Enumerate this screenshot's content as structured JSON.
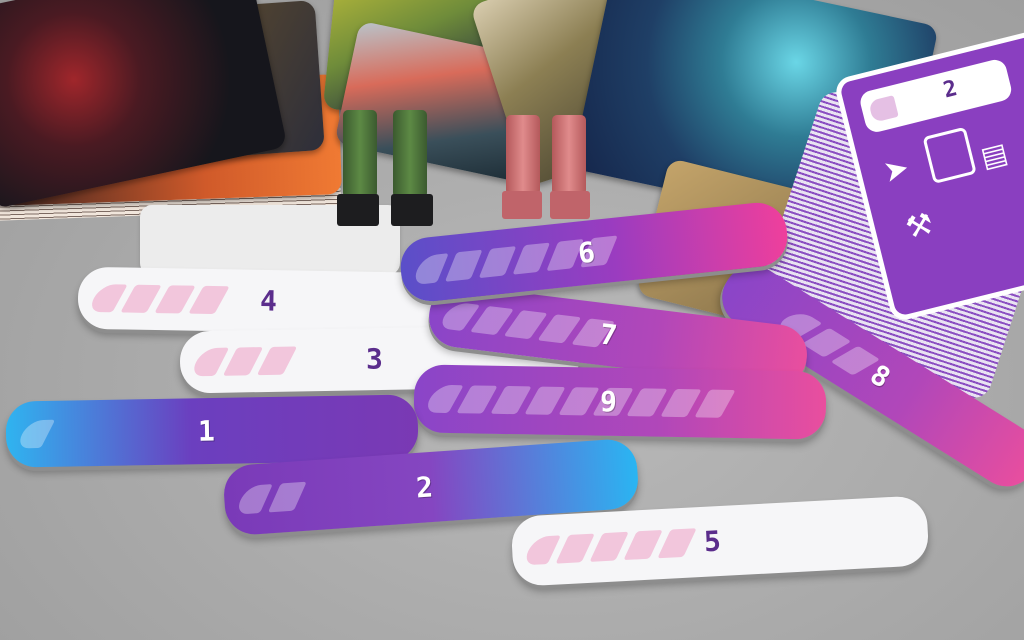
{
  "scene": {
    "description_colors": {
      "table": "#a9a9a9",
      "token_white": "#f6f6f8",
      "token_pink_stripe": "#f2c6dc",
      "token_purple": "#7a39b4",
      "token_blue": "#2fb4f0",
      "token_magenta": "#ef3f9c",
      "number_on_white": "#5b2d8c"
    },
    "tokens": [
      {
        "label": "1",
        "style": "gradient",
        "level": 1
      },
      {
        "label": "2",
        "style": "gradient",
        "level": 2
      },
      {
        "label": "3",
        "style": "white",
        "level": 3
      },
      {
        "label": "4",
        "style": "white",
        "level": 4
      },
      {
        "label": "5",
        "style": "white",
        "level": 5
      },
      {
        "label": "6",
        "style": "gradient",
        "level": 6
      },
      {
        "label": "7",
        "style": "gradient",
        "level": 7
      },
      {
        "label": "8",
        "style": "gradient",
        "level": 8
      },
      {
        "label": "9",
        "style": "gradient",
        "level": 9
      }
    ],
    "right_deck": {
      "top_card_number": "2",
      "icons": [
        "cursor-icon",
        "calculator-icon",
        "connector-icon",
        "tool-icon"
      ]
    }
  }
}
